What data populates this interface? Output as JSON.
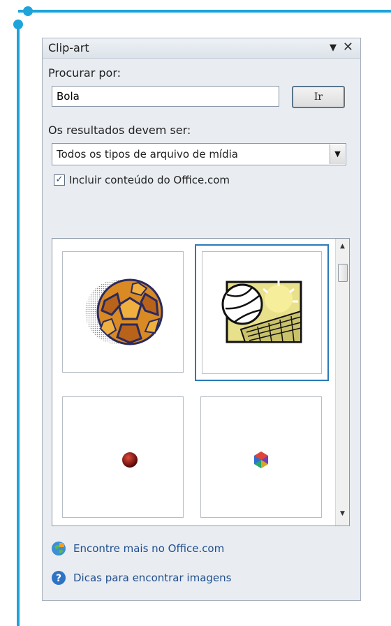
{
  "pane": {
    "title": "Clip-art",
    "dropdown_glyph": "▼",
    "close_glyph": "✕"
  },
  "search": {
    "label": "Procurar por:",
    "value": "Bola",
    "go_label": "Ir"
  },
  "results_filter": {
    "label": "Os resultados devem ser:",
    "selected": "Todos os tipos de arquivo de mídia",
    "arrow_glyph": "▼"
  },
  "include_office": {
    "checked": true,
    "check_glyph": "✓",
    "label": "Incluir conteúdo do Office.com"
  },
  "results": {
    "items": [
      {
        "icon": "soccer-ball-clipart",
        "selected": false
      },
      {
        "icon": "volleyball-net-clipart",
        "selected": true
      },
      {
        "icon": "red-ball-clipart",
        "selected": false
      },
      {
        "icon": "colorful-ball-clipart",
        "selected": false
      }
    ],
    "scroll_up_glyph": "▲",
    "scroll_down_glyph": "▼"
  },
  "links": {
    "office_link": "Encontre mais no Office.com",
    "tips_link": "Dicas para encontrar imagens"
  },
  "colors": {
    "accent_frame": "#1ea4db",
    "link": "#1f4e8c",
    "selection_border": "#2a7ab8"
  }
}
